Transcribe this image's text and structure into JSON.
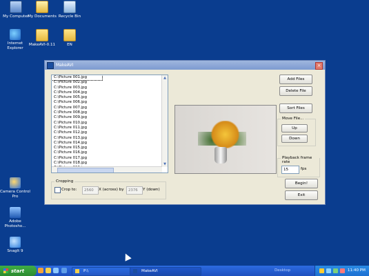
{
  "desktop_icons": [
    {
      "label": "My Computer",
      "icon": "computer-icon"
    },
    {
      "label": "My Documents",
      "icon": "documents-icon"
    },
    {
      "label": "Recycle Bin",
      "icon": "recycle-bin-icon"
    },
    {
      "label": "Internet Explorer",
      "icon": "internet-explorer-icon"
    },
    {
      "label": "MakeAVI-0.11",
      "icon": "folder-icon"
    },
    {
      "label": "EN",
      "icon": "folder-icon"
    },
    {
      "label": "Camera Control Pro",
      "icon": "camera-control-icon"
    },
    {
      "label": "Adobe Photosho...",
      "icon": "photoshop-icon"
    },
    {
      "label": "SnagIt 9",
      "icon": "snagit-icon"
    }
  ],
  "window": {
    "title": "MakeAVI",
    "files": [
      "C:\\Picture 001.jpg",
      "C:\\Picture 002.jpg",
      "C:\\Picture 003.jpg",
      "C:\\Picture 004.jpg",
      "C:\\Picture 005.jpg",
      "C:\\Picture 006.jpg",
      "C:\\Picture 007.jpg",
      "C:\\Picture 008.jpg",
      "C:\\Picture 009.jpg",
      "C:\\Picture 010.jpg",
      "C:\\Picture 011.jpg",
      "C:\\Picture 012.jpg",
      "C:\\Picture 013.jpg",
      "C:\\Picture 014.jpg",
      "C:\\Picture 015.jpg",
      "C:\\Picture 016.jpg",
      "C:\\Picture 017.jpg",
      "C:\\Picture 018.jpg",
      "C:\\Picture 019.jpg"
    ],
    "buttons": {
      "add": "Add Files",
      "delete": "Delete File",
      "sort": "Sort Files",
      "move_group": "Move File...",
      "up": "Up",
      "down": "Down",
      "begin": "Begin!",
      "exit": "Exit"
    },
    "playback": {
      "label": "Playback frame rate",
      "value": "15",
      "unit": "fps"
    },
    "cropping": {
      "label": "Cropping",
      "checkbox": "Crop to:",
      "x_value": "2560",
      "x_label": "X (across) by",
      "y_value": "2376",
      "y_label": "Y (down)"
    }
  },
  "taskbar": {
    "start": "start",
    "tasks": [
      "P:\\",
      "MakeAVI"
    ],
    "desktop": "Desktop",
    "clock": "11:40 PM"
  },
  "colors": {
    "desktop_bg": "#0a3d8f",
    "window_bg": "#ece9d8",
    "taskbar": "#245edb"
  }
}
